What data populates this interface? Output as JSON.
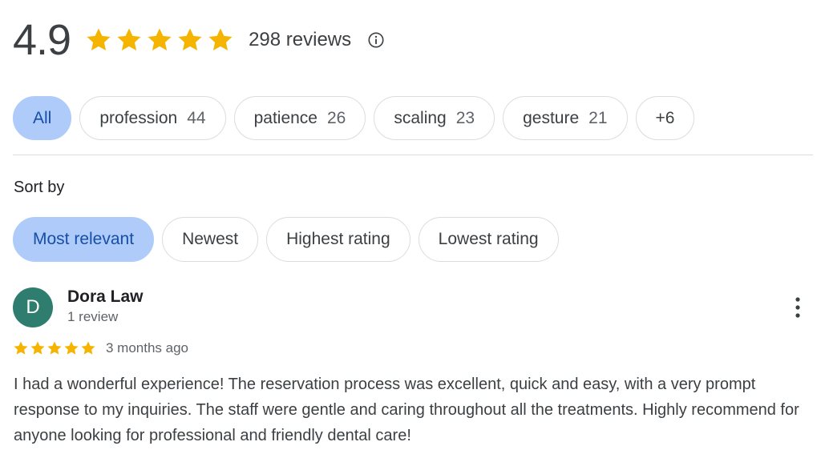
{
  "summary": {
    "rating": "4.9",
    "stars": 5,
    "review_count": "298 reviews",
    "star_color": "#f4b400"
  },
  "topics": [
    {
      "label": "All",
      "count": "",
      "active": true
    },
    {
      "label": "profession",
      "count": "44",
      "active": false
    },
    {
      "label": "patience",
      "count": "26",
      "active": false
    },
    {
      "label": "scaling",
      "count": "23",
      "active": false
    },
    {
      "label": "gesture",
      "count": "21",
      "active": false
    },
    {
      "label": "+6",
      "count": "",
      "active": false
    }
  ],
  "sort": {
    "label": "Sort by",
    "options": [
      {
        "label": "Most relevant",
        "active": true
      },
      {
        "label": "Newest",
        "active": false
      },
      {
        "label": "Highest rating",
        "active": false
      },
      {
        "label": "Lowest rating",
        "active": false
      }
    ]
  },
  "review": {
    "avatar_letter": "D",
    "avatar_color": "#2e7d6f",
    "name": "Dora Law",
    "meta": "1 review",
    "stars": 5,
    "date": "3 months ago",
    "text": "I had a wonderful experience! The reservation process was excellent, quick and easy, with a very prompt response to my inquiries. The staff were gentle and caring throughout all the treatments. Highly recommend for anyone looking for professional and friendly dental care!"
  }
}
